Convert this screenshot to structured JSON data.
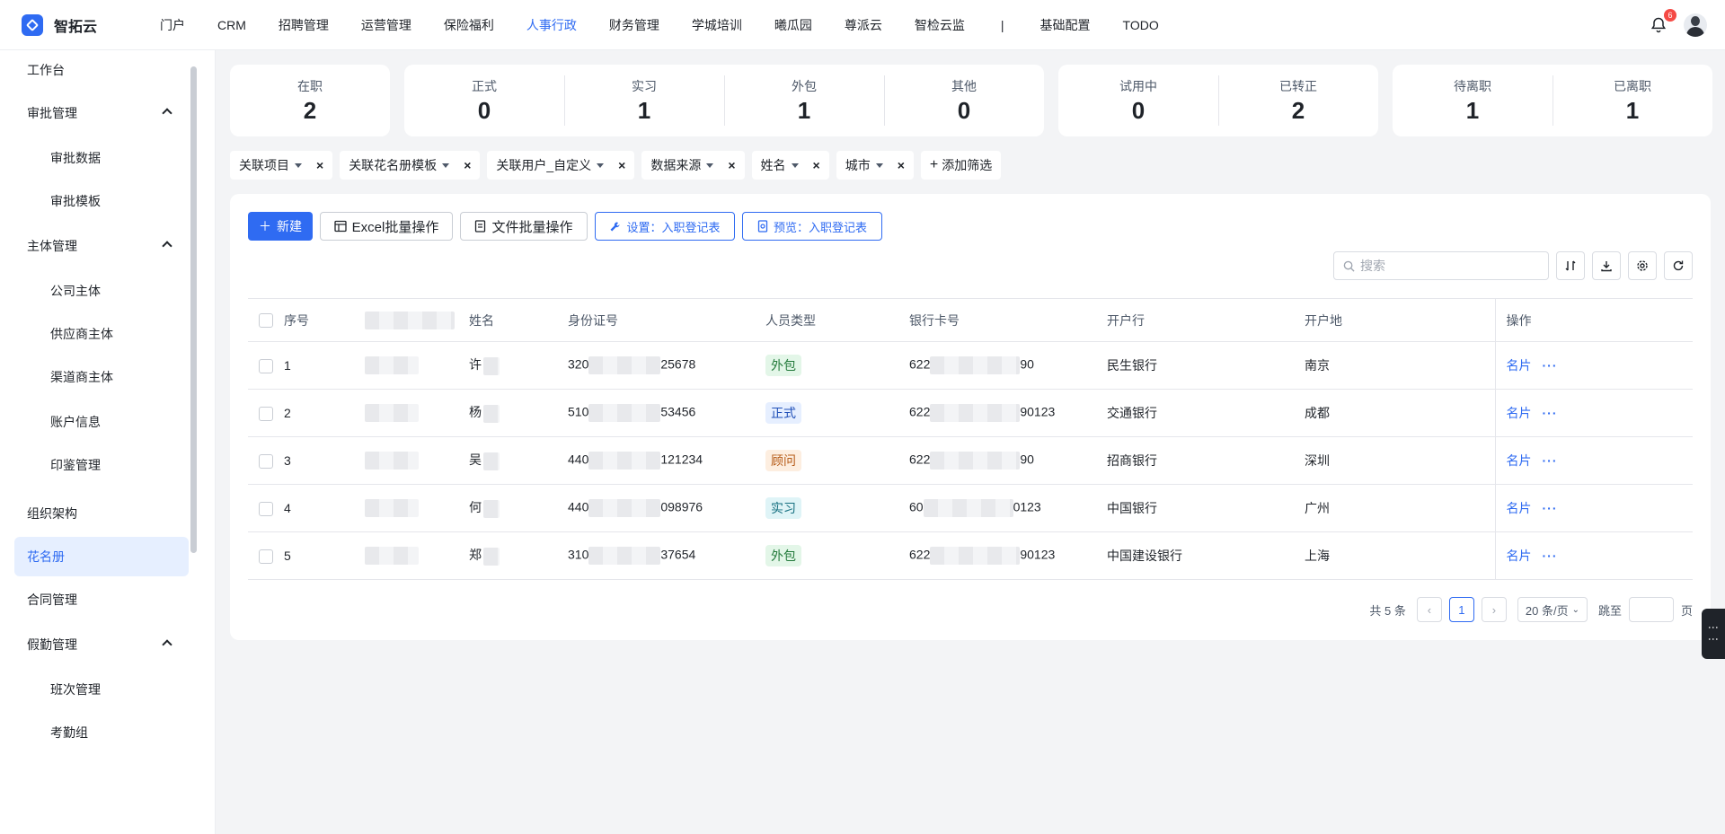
{
  "app": {
    "name": "智拓云"
  },
  "nav": {
    "items": [
      "门户",
      "CRM",
      "招聘管理",
      "运营管理",
      "保险福利",
      "人事行政",
      "财务管理",
      "学城培训",
      "曦瓜园",
      "尊派云",
      "智检云监",
      "|",
      "基础配置",
      "TODO"
    ],
    "active_index": 5,
    "notification_count": "6"
  },
  "sidebar": {
    "items": [
      {
        "label": "工作台",
        "level": 1
      },
      {
        "label": "审批管理",
        "level": 1,
        "expanded": true
      },
      {
        "label": "审批数据",
        "level": 2
      },
      {
        "label": "审批模板",
        "level": 2
      },
      {
        "label": "主体管理",
        "level": 1,
        "expanded": true
      },
      {
        "label": "公司主体",
        "level": 2
      },
      {
        "label": "供应商主体",
        "level": 2
      },
      {
        "label": "渠道商主体",
        "level": 2
      },
      {
        "label": "账户信息",
        "level": 2
      },
      {
        "label": "印鉴管理",
        "level": 2
      },
      {
        "label": "组织架构",
        "level": 1
      },
      {
        "label": "花名册",
        "level": 1,
        "active": true
      },
      {
        "label": "合同管理",
        "level": 1
      },
      {
        "label": "假勤管理",
        "level": 1,
        "expanded": true
      },
      {
        "label": "班次管理",
        "level": 2
      },
      {
        "label": "考勤组",
        "level": 2
      }
    ]
  },
  "stats": {
    "card1": [
      {
        "label": "在职",
        "value": "2"
      }
    ],
    "card2": [
      {
        "label": "正式",
        "value": "0"
      },
      {
        "label": "实习",
        "value": "1"
      },
      {
        "label": "外包",
        "value": "1"
      },
      {
        "label": "其他",
        "value": "0"
      }
    ],
    "card3": [
      {
        "label": "试用中",
        "value": "0"
      },
      {
        "label": "已转正",
        "value": "2"
      }
    ],
    "card4": [
      {
        "label": "待离职",
        "value": "1"
      },
      {
        "label": "已离职",
        "value": "1"
      }
    ]
  },
  "filters": [
    "关联项目",
    "关联花名册模板",
    "关联用户_自定义",
    "数据来源",
    "姓名",
    "城市"
  ],
  "filters_add": "添加筛选",
  "toolbar": {
    "new": "新建",
    "excel": "Excel批量操作",
    "file": "文件批量操作",
    "settings": "设置：入职登记表",
    "preview": "预览：入职登记表",
    "search_placeholder": "搜索"
  },
  "table": {
    "headers": {
      "seq": "序号",
      "name": "姓名",
      "id": "身份证号",
      "type": "人员类型",
      "bank_card": "银行卡号",
      "bank": "开户行",
      "city": "开户地",
      "op": "操作"
    },
    "rows": [
      {
        "seq": "1",
        "name": "许",
        "id_prefix": "320",
        "id_suffix": "25678",
        "type": "外包",
        "card_prefix": "622",
        "card_suffix": "90",
        "bank": "民生银行",
        "city": "南京"
      },
      {
        "seq": "2",
        "name": "杨",
        "id_prefix": "510",
        "id_suffix": "53456",
        "type": "正式",
        "card_prefix": "622",
        "card_suffix": "90123",
        "bank": "交通银行",
        "city": "成都"
      },
      {
        "seq": "3",
        "name": "吴",
        "id_prefix": "440",
        "id_suffix": "121234",
        "type": "顾问",
        "card_prefix": "622",
        "card_suffix": "90",
        "bank": "招商银行",
        "city": "深圳"
      },
      {
        "seq": "4",
        "name": "何",
        "id_prefix": "440",
        "id_suffix": "098976",
        "type": "实习",
        "card_prefix": "60",
        "card_suffix": "0123",
        "bank": "中国银行",
        "city": "广州"
      },
      {
        "seq": "5",
        "name": "郑",
        "id_prefix": "310",
        "id_suffix": "37654",
        "type": "外包",
        "card_prefix": "622",
        "card_suffix": "90123",
        "bank": "中国建设银行",
        "city": "上海"
      }
    ],
    "op_link": "名片"
  },
  "tag_colors": {
    "外包": {
      "bg": "#e3f6e8",
      "fg": "#237a3b"
    },
    "正式": {
      "bg": "#e6efff",
      "fg": "#1f4fb8"
    },
    "顾问": {
      "bg": "#fdeee0",
      "fg": "#b55a16"
    },
    "实习": {
      "bg": "#dff4f7",
      "fg": "#156f80"
    }
  },
  "pagination": {
    "total": "共 5 条",
    "current": "1",
    "page_size": "20 条/页",
    "jump_label": "跳至",
    "page_unit": "页"
  }
}
